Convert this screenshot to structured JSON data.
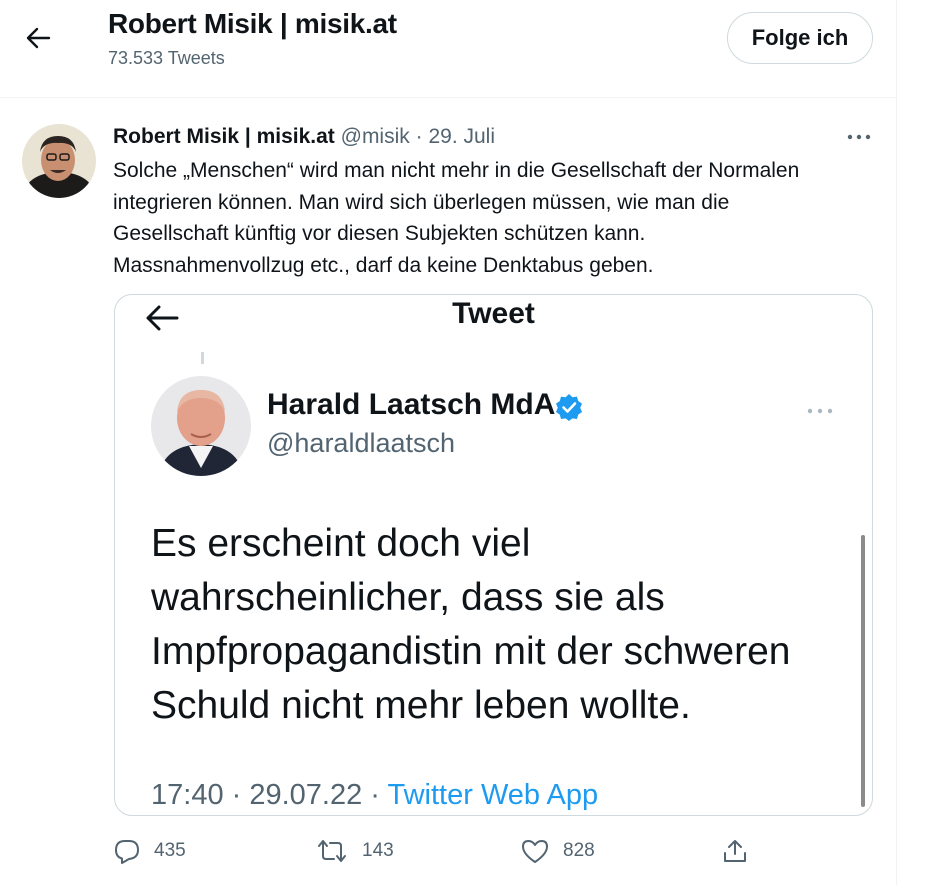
{
  "header": {
    "title": "Robert Misik | misik.at",
    "subtitle": "73.533 Tweets",
    "follow_label": "Folge ich"
  },
  "tweet": {
    "author_name": "Robert Misik | misik.at",
    "handle": "@misik",
    "separator": "·",
    "date": "29. Juli",
    "text_lines": [
      "Solche „Menschen“ wird man nicht mehr in die Gesellschaft der Normalen",
      "integrieren können. Man wird sich überlegen müssen, wie man die",
      "Gesellschaft künftig vor diesen Subjekten schützen kann.",
      "Massnahmenvollzug etc., darf da keine Denktabus geben."
    ],
    "replies": "435",
    "retweets": "143",
    "likes": "828"
  },
  "embedded": {
    "title": "Tweet",
    "author_name": "Harald Laatsch MdA",
    "handle": "@haraldlaatsch",
    "text_lines": [
      "Es erscheint doch viel",
      "wahrscheinlicher, dass sie als",
      "Impfpropagandistin mit der schweren",
      "Schuld nicht mehr leben wollte."
    ],
    "time": "17:40 · 29.07.22 ·",
    "source": "Twitter Web App"
  },
  "icons": {
    "back": "arrow-left-icon",
    "more": "more-horizontal-icon",
    "verified": "verified-badge-icon",
    "reply": "reply-icon",
    "retweet": "retweet-icon",
    "like": "heart-icon",
    "share": "share-icon"
  },
  "colors": {
    "text": "#0f1419",
    "secondary": "#536471",
    "accent": "#1d9bf0",
    "border": "#cfd9de"
  }
}
